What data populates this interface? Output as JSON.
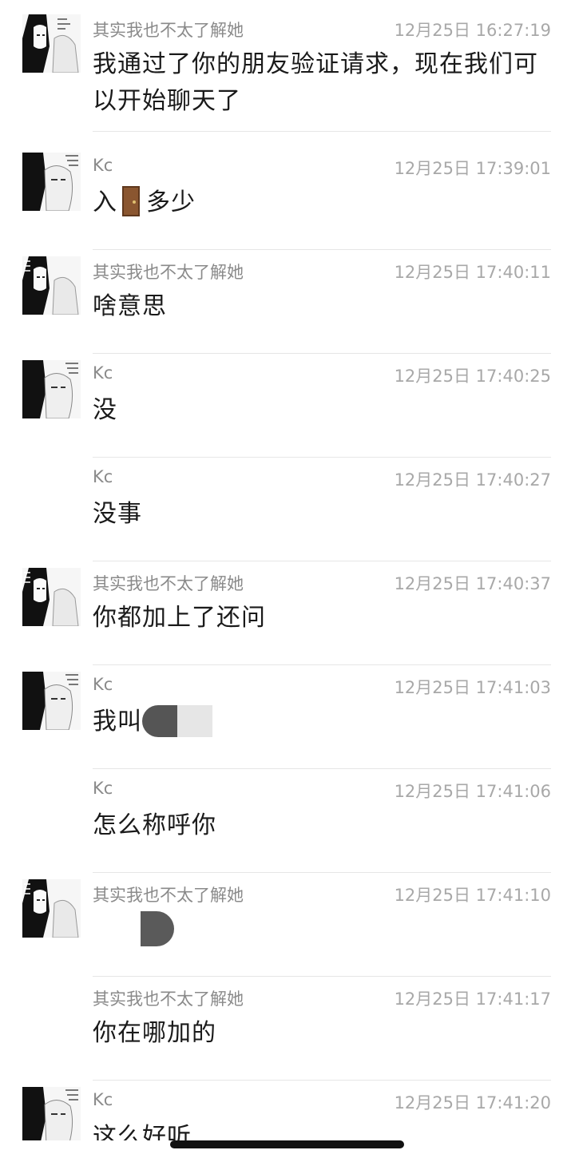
{
  "messages": [
    {
      "sender": "其实我也不太了解她",
      "time": "12月25日 16:27:19",
      "text": "我通过了你的朋友验证请求，现在我们可以开始聊天了",
      "avatar": true
    },
    {
      "sender": "Kc",
      "time": "12月25日 17:39:01",
      "text_before": "入",
      "emoji": "door",
      "text_after": "多少",
      "avatar": true
    },
    {
      "sender": "其实我也不太了解她",
      "time": "12月25日 17:40:11",
      "text": "啥意思",
      "avatar": true
    },
    {
      "sender": "Kc",
      "time": "12月25日 17:40:25",
      "text": "没",
      "avatar": true
    },
    {
      "sender": "Kc",
      "time": "12月25日 17:40:27",
      "text": "没事",
      "avatar": false
    },
    {
      "sender": "其实我也不太了解她",
      "time": "12月25日 17:40:37",
      "text": "你都加上了还问",
      "avatar": true
    },
    {
      "sender": "Kc",
      "time": "12月25日 17:41:03",
      "text": "我叫",
      "redacted": true,
      "avatar": true
    },
    {
      "sender": "Kc",
      "time": "12月25日 17:41:06",
      "text": "怎么称呼你",
      "avatar": false
    },
    {
      "sender": "其实我也不太了解她",
      "time": "12月25日 17:41:10",
      "text": "",
      "redacted": true,
      "avatar": true
    },
    {
      "sender": "其实我也不太了解她",
      "time": "12月25日 17:41:17",
      "text": "你在哪加的",
      "avatar": false
    },
    {
      "sender": "Kc",
      "time": "12月25日 17:41:20",
      "text": "这么好听",
      "avatar": true
    }
  ],
  "colors": {
    "name": "#8a8a8a",
    "time": "#a8a8a8",
    "text": "#1a1a1a",
    "divider": "#e6e6e6"
  },
  "icons": {
    "avatar": "manga-avatar-icon",
    "emoji": "door-emoji-icon"
  }
}
